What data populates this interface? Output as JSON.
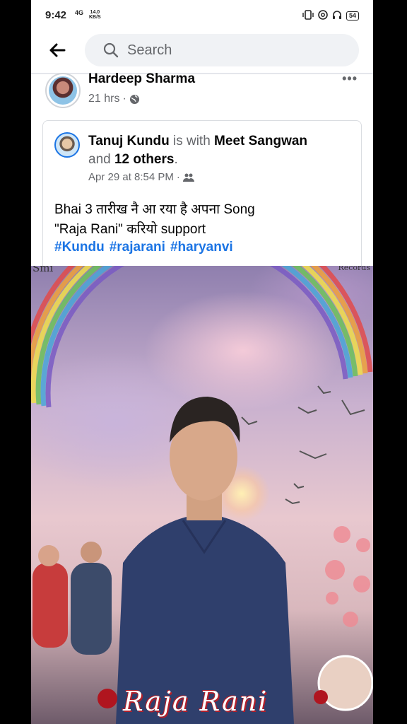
{
  "status_bar": {
    "time": "9:42",
    "network": "4G",
    "speed_value": "14.0",
    "speed_unit": "KB/S",
    "battery": "54"
  },
  "search": {
    "placeholder": "Search"
  },
  "post": {
    "author": "Hardeep Sharma",
    "time": "21 hrs",
    "privacy_icon": "globe-icon",
    "shared": {
      "author": "Tanuj Kundu",
      "with_text": "is with",
      "tagged": "Meet Sangwan",
      "and_text": "and",
      "others": "12 others",
      "period": ".",
      "date": "Apr 29 at 8:54 PM",
      "audience_icon": "friends-icon",
      "text_line1": "Bhai 3 तारीख नै आ रया है अपना Song",
      "text_line2": "\"Raja Rani\" करियो support",
      "hashtags": [
        "#Kundu",
        "#rajarani",
        "#haryanvi"
      ]
    },
    "image": {
      "corner_left": "Smi",
      "corner_right": "Records",
      "title": "Raja Rani"
    }
  }
}
